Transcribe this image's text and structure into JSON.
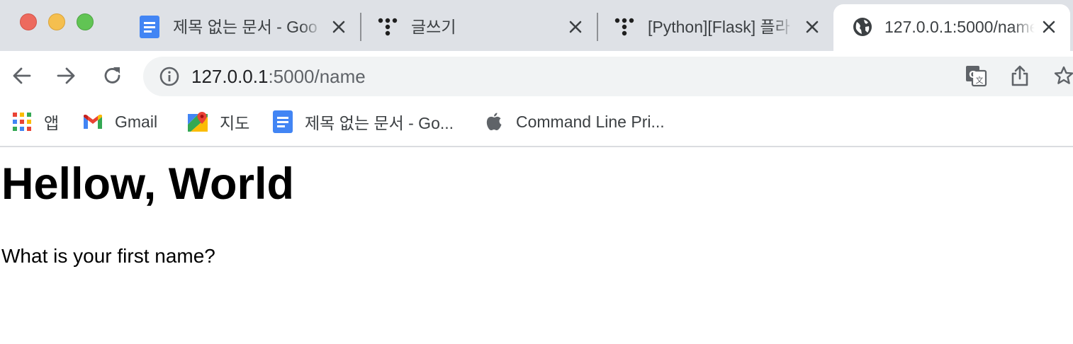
{
  "window": {
    "traffic_lights": {
      "close_color": "#ed6a5e",
      "minimize_color": "#f5bf4f",
      "zoom_color": "#61c454"
    }
  },
  "tabs": [
    {
      "title": "제목 없는 문서 - Goo",
      "icon": "google-docs-icon",
      "active": false
    },
    {
      "title": "글쓰기",
      "icon": "tistory-icon",
      "active": false
    },
    {
      "title": "[Python][Flask] 플라",
      "icon": "tistory-icon",
      "active": false
    },
    {
      "title": "127.0.0.1:5000/name",
      "icon": "globe-icon",
      "active": true
    }
  ],
  "toolbar": {
    "back_icon": "back-arrow-icon",
    "forward_icon": "forward-arrow-icon",
    "reload_icon": "reload-icon",
    "url_host": "127.0.0.1",
    "url_path": ":5000/name",
    "right_icons": [
      "translate-icon",
      "share-icon",
      "bookmark-star-icon"
    ]
  },
  "bookmarks": [
    {
      "label": "앱",
      "icon": "apps-grid-icon"
    },
    {
      "label": "Gmail",
      "icon": "gmail-icon"
    },
    {
      "label": "지도",
      "icon": "google-maps-icon"
    },
    {
      "label": "제목 없는 문서 - Go...",
      "icon": "google-docs-icon"
    },
    {
      "label": "Command Line Pri...",
      "icon": "apple-icon"
    }
  ],
  "page": {
    "heading": "Hellow, World",
    "question": "What is your first name?"
  },
  "colors": {
    "tabstrip_bg": "#dee1e6",
    "omnibox_bg": "#f1f3f4",
    "docs_blue": "#4285f4"
  }
}
